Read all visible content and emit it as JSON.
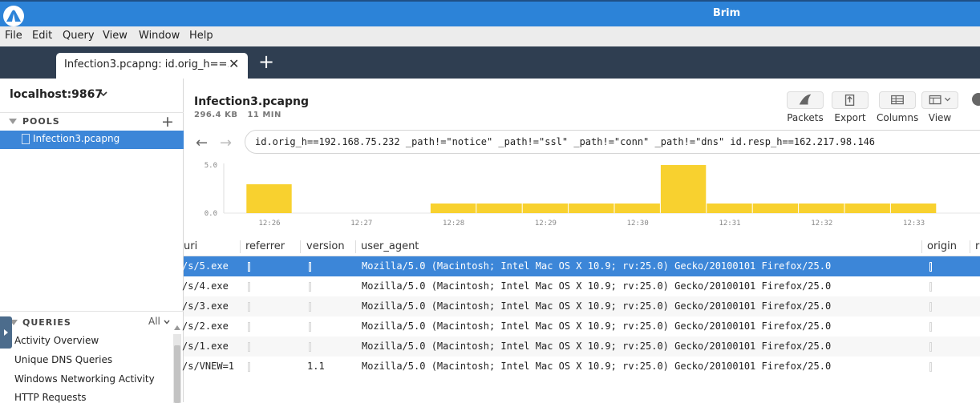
{
  "window": {
    "title": "Brim"
  },
  "menu": {
    "items": [
      "File",
      "Edit",
      "Query",
      "View",
      "Window",
      "Help"
    ]
  },
  "tab": {
    "label": "Infection3.pcapng: id.orig_h==...",
    "close": "✕",
    "new": "+"
  },
  "sidebar": {
    "host": "localhost:9867",
    "pools_title": "POOLS",
    "pools": [
      {
        "name": "Infection3.pcapng",
        "selected": true
      }
    ],
    "queries_title": "QUERIES",
    "queries_filter": "All",
    "queries": [
      "Activity Overview",
      "Unique DNS Queries",
      "Windows Networking Activity",
      "HTTP Requests"
    ]
  },
  "main": {
    "file_title": "Infection3.pcapng",
    "file_size": "296.4 KB",
    "file_duration": "11 MIN",
    "toolbar": {
      "packets": "Packets",
      "export": "Export",
      "columns": "Columns",
      "view": "View"
    },
    "search_value": "id.orig_h==192.168.75.232 _path!=\"notice\" _path!=\"ssl\" _path!=\"conn\" _path!=\"dns\" id.resp_h==162.217.98.146"
  },
  "chart_data": {
    "type": "bar",
    "yticks": [
      "5.0",
      "0.0"
    ],
    "ylim": [
      0,
      5
    ],
    "xticks": [
      "12:26",
      "12:27",
      "12:28",
      "12:29",
      "12:30",
      "12:31",
      "12:32",
      "12:33"
    ],
    "bars": [
      {
        "start": "12:25:45",
        "end": "12:26:15",
        "value": 3
      },
      {
        "start": "12:27:45",
        "end": "12:28:15",
        "value": 1
      },
      {
        "start": "12:28:15",
        "end": "12:28:45",
        "value": 1
      },
      {
        "start": "12:28:45",
        "end": "12:29:15",
        "value": 1
      },
      {
        "start": "12:29:15",
        "end": "12:29:45",
        "value": 1
      },
      {
        "start": "12:29:45",
        "end": "12:30:15",
        "value": 1
      },
      {
        "start": "12:30:15",
        "end": "12:30:45",
        "value": 5
      },
      {
        "start": "12:30:45",
        "end": "12:31:15",
        "value": 1
      },
      {
        "start": "12:31:15",
        "end": "12:31:45",
        "value": 1
      },
      {
        "start": "12:31:45",
        "end": "12:32:15",
        "value": 1
      },
      {
        "start": "12:32:15",
        "end": "12:32:45",
        "value": 1
      },
      {
        "start": "12:32:45",
        "end": "12:33:15",
        "value": 1
      },
      {
        "start": "12:33:45",
        "end": "12:34:15",
        "value": 1
      }
    ],
    "color": "#f8d12f"
  },
  "table": {
    "columns": [
      "uri",
      "referrer",
      "version",
      "user_agent",
      "origin",
      "r"
    ],
    "rows": [
      {
        "uri": "/s/5.exe",
        "version": "",
        "user_agent": "Mozilla/5.0 (Macintosh; Intel Mac OS X 10.9; rv:25.0) Gecko/20100101 Firefox/25.0"
      },
      {
        "uri": "/s/4.exe",
        "version": "",
        "user_agent": "Mozilla/5.0 (Macintosh; Intel Mac OS X 10.9; rv:25.0) Gecko/20100101 Firefox/25.0"
      },
      {
        "uri": "/s/3.exe",
        "version": "",
        "user_agent": "Mozilla/5.0 (Macintosh; Intel Mac OS X 10.9; rv:25.0) Gecko/20100101 Firefox/25.0"
      },
      {
        "uri": "/s/2.exe",
        "version": "",
        "user_agent": "Mozilla/5.0 (Macintosh; Intel Mac OS X 10.9; rv:25.0) Gecko/20100101 Firefox/25.0"
      },
      {
        "uri": "/s/1.exe",
        "version": "",
        "user_agent": "Mozilla/5.0 (Macintosh; Intel Mac OS X 10.9; rv:25.0) Gecko/20100101 Firefox/25.0"
      },
      {
        "uri": "/s/VNEW=1",
        "version": "1.1",
        "user_agent": "Mozilla/5.0 (Macintosh; Intel Mac OS X 10.9; rv:25.0) Gecko/20100101 Firefox/25.0"
      }
    ]
  },
  "colors": {
    "accent": "#3c86d8",
    "titlebar": "#2c83d8",
    "tabbar": "#2f3e51",
    "bar": "#f8d12f"
  }
}
